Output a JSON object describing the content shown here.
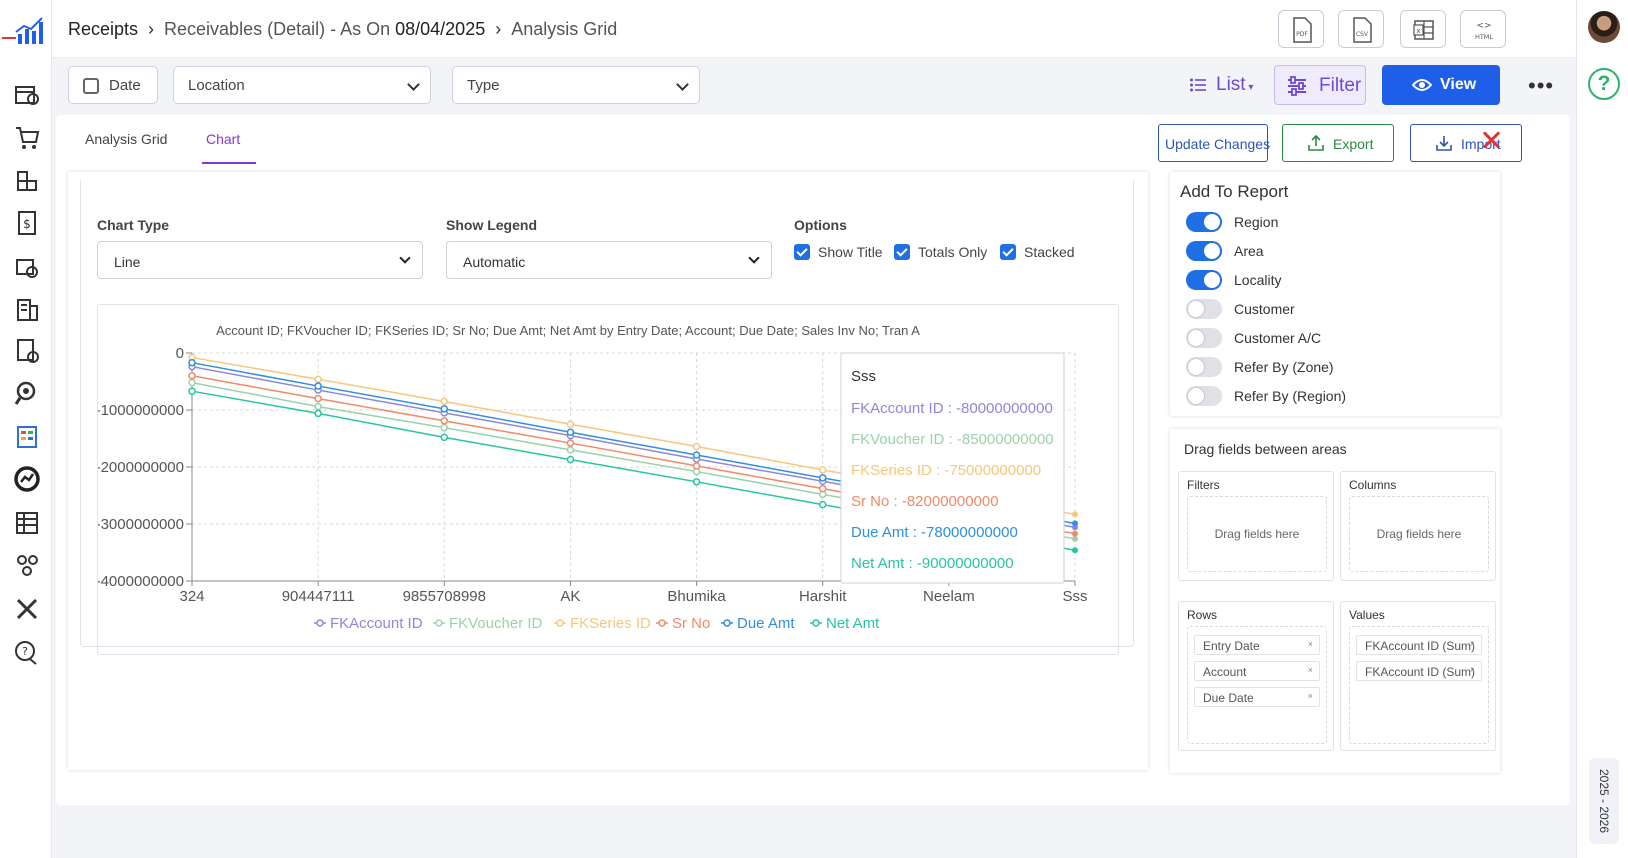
{
  "breadcrumb": {
    "item1": "Receipts",
    "item2": "Receivables (Detail) - As On ",
    "item2_date": "08/04/2025",
    "item3": "Analysis Grid"
  },
  "export_buttons": [
    "pdf-icon",
    "csv-icon",
    "excel-icon",
    "html-icon"
  ],
  "filters": {
    "date_label": "Date",
    "location_label": "Location",
    "type_label": "Type"
  },
  "toolbar": {
    "list_label": "List",
    "filter_label": "Filter",
    "view_label": "View",
    "more_label": "•••"
  },
  "tabs": [
    {
      "label": "Analysis Grid",
      "active": false
    },
    {
      "label": "Chart",
      "active": true
    }
  ],
  "actions": {
    "update_label": "Update Changes",
    "export_label": "Export",
    "import_label": "Import"
  },
  "chart_settings": {
    "chart_type_label": "Chart Type",
    "chart_type_value": "Line",
    "show_legend_label": "Show Legend",
    "show_legend_value": "Automatic",
    "options_label": "Options",
    "options": [
      {
        "label": "Show Title",
        "checked": true
      },
      {
        "label": "Totals Only",
        "checked": true
      },
      {
        "label": "Stacked",
        "checked": true
      }
    ]
  },
  "chart_data": {
    "type": "line",
    "title": "Account ID; FKVoucher ID; FKSeries ID; Sr No; Due Amt; Net Amt by Entry Date; Account; Due Date; Sales Inv No; Tran A",
    "categories": [
      "324",
      "904447111",
      "9855708998",
      "AK",
      "Bhumika",
      "Harshit",
      "Neelam",
      "Sss"
    ],
    "y_tick_labels": [
      "0",
      "-1000000000",
      "-2000000000",
      "-3000000000",
      "-4000000000"
    ],
    "ylim": [
      -4000000000,
      0
    ],
    "grid": true,
    "legend_position": "bottom",
    "stacked": true,
    "series": [
      {
        "name": "FKAccount ID",
        "color": "#8f86d9",
        "values": [
          -240000000,
          -650000000,
          -1050000000,
          -1450000000,
          -1860000000,
          -2250000000,
          -2650000000,
          -3060000000
        ]
      },
      {
        "name": "FKVoucher ID",
        "color": "#9ad2a8",
        "values": [
          -520000000,
          -940000000,
          -1310000000,
          -1700000000,
          -2080000000,
          -2480000000,
          -2870000000,
          -3260000000
        ]
      },
      {
        "name": "FKSeries ID",
        "color": "#f7c77a",
        "values": [
          -80000000,
          -460000000,
          -850000000,
          -1250000000,
          -1640000000,
          -2050000000,
          -2450000000,
          -2830000000
        ]
      },
      {
        "name": "Sr No",
        "color": "#f08a68",
        "values": [
          -400000000,
          -800000000,
          -1190000000,
          -1580000000,
          -1980000000,
          -2380000000,
          -2780000000,
          -3170000000
        ]
      },
      {
        "name": "Due Amt",
        "color": "#2f8fe0",
        "values": [
          -170000000,
          -580000000,
          -980000000,
          -1390000000,
          -1790000000,
          -2190000000,
          -2590000000,
          -2990000000
        ]
      },
      {
        "name": "Net Amt",
        "color": "#26c6a2",
        "values": [
          -670000000,
          -1060000000,
          -1480000000,
          -1870000000,
          -2260000000,
          -2660000000,
          -3060000000,
          -3460000000
        ]
      }
    ],
    "tooltip": {
      "title": "Sss",
      "lines": [
        {
          "text": "FKAccount ID : -80000000000",
          "color": "#8f86d9"
        },
        {
          "text": "FKVoucher ID : -85000000000",
          "color": "#9ad2a8"
        },
        {
          "text": "FKSeries ID : -75000000000",
          "color": "#f7c77a"
        },
        {
          "text": "Sr No : -82000000000",
          "color": "#f08a68"
        },
        {
          "text": "Due Amt : -78000000000",
          "color": "#2f8fe0"
        },
        {
          "text": "Net Amt : -90000000000",
          "color": "#26c6a2"
        }
      ]
    }
  },
  "report": {
    "title": "Add To Report",
    "items": [
      {
        "label": "Region",
        "on": true
      },
      {
        "label": "Area",
        "on": true
      },
      {
        "label": "Locality",
        "on": true
      },
      {
        "label": "Customer",
        "on": false
      },
      {
        "label": "Customer A/C",
        "on": false
      },
      {
        "label": "Refer By (Zone)",
        "on": false
      },
      {
        "label": "Refer By (Region)",
        "on": false
      }
    ]
  },
  "pivot": {
    "title": "Drag fields between areas",
    "filters_label": "Filters",
    "columns_label": "Columns",
    "rows_label": "Rows",
    "values_label": "Values",
    "drag_hint": "Drag fields here",
    "rows": [
      "Entry Date",
      "Account",
      "Due Date"
    ],
    "values": [
      "FKAccount ID (Sum)",
      "FKAccount ID (Sum)"
    ],
    "chip_remove": "×"
  },
  "footer": {
    "year": "2025 - 2026"
  },
  "colors": {
    "accent": "#1f5ee8",
    "purple": "#6d4bd0",
    "tab_active": "#8a36c9",
    "close": "#e23333"
  }
}
